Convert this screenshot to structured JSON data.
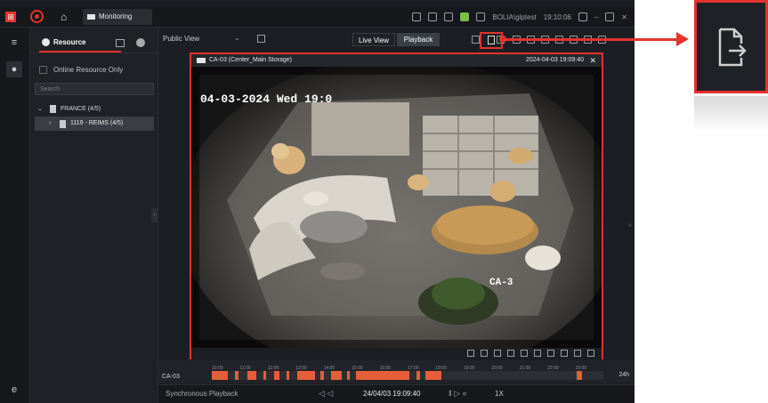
{
  "titlebar": {
    "home_tab_label": "Monitoring",
    "user": "BOLIA\\glptest",
    "clock": "19:10:06"
  },
  "sidebar": {
    "tab_resource": "Resource",
    "online_only": "Online Resource Only",
    "search_placeholder": "Search",
    "tree": [
      {
        "label": "FRANCE (4/5)"
      },
      {
        "label": "1119 - REIMS (4/5)"
      }
    ]
  },
  "toolbar": {
    "view_label": "Public View",
    "live_view": "Live View",
    "playback": "Playback"
  },
  "video_window": {
    "title": "CA-03 (Center_Main Storage)",
    "timestamp": "2024-04-03 19:09:40",
    "osd_text": "04-03-2024 Wed 19:0",
    "osd_cam": "CA-3"
  },
  "timeline": {
    "camera": "CA-03",
    "range_label": "24h",
    "ticks": [
      "10:00",
      "11:00",
      "12:00",
      "13:00",
      "14:00",
      "15:00",
      "16:00",
      "17:00",
      "18:00",
      "19:00",
      "20:00",
      "21:00",
      "22:00",
      "23:00"
    ]
  },
  "bottombar": {
    "sync_label": "Synchronous Playback",
    "datetime": "24/04/03 19:09:40",
    "speed": "1X"
  },
  "colors": {
    "accent": "#e5322d",
    "bg_dark": "#1b1e22"
  },
  "icons": {
    "export": "export-icon"
  }
}
